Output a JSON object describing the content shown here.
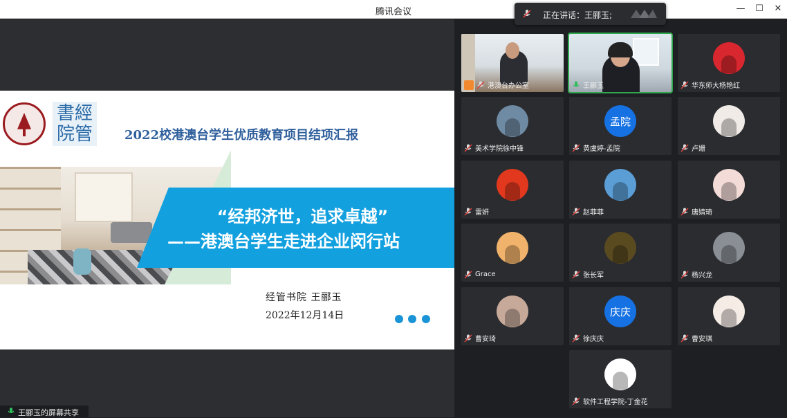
{
  "window": {
    "title": "腾讯会议",
    "minimize": "—",
    "maximize": "☐",
    "close": "✕"
  },
  "speaking": {
    "label": "正在讲话：王郦玉;"
  },
  "slide": {
    "title": "2022校港澳台学生优质教育项目结项汇报",
    "callig": "書經\n院管",
    "banner_line1": "“经邦济世，追求卓越”",
    "banner_line2": "——港澳台学生走进企业闵行站",
    "presenter": "经管书院 王郦玉",
    "date": "2022年12月14日"
  },
  "share_label": "王郦玉的屏幕共享",
  "participants": [
    {
      "name": "港澳台办公室",
      "type": "video"
    },
    {
      "name": "王郦玉",
      "type": "video",
      "active": true
    },
    {
      "name": "华东师大杨艳红",
      "type": "photo",
      "color": "#d8272f"
    },
    {
      "name": "美术学院徐中锋",
      "type": "photo",
      "color": "#6f8aa3"
    },
    {
      "name": "黄虞婷-孟院",
      "type": "text",
      "initials": "孟院"
    },
    {
      "name": "卢姗",
      "type": "photo",
      "color": "#f0ebe7"
    },
    {
      "name": "雷妍",
      "type": "photo",
      "color": "#e2381e"
    },
    {
      "name": "赵菲菲",
      "type": "photo",
      "color": "#5b9ed6"
    },
    {
      "name": "唐婧琦",
      "type": "photo",
      "color": "#f3dcd8"
    },
    {
      "name": "Grace",
      "type": "photo",
      "color": "#f1b36b"
    },
    {
      "name": "张长军",
      "type": "photo",
      "color": "#5a4a20"
    },
    {
      "name": "杨兴龙",
      "type": "photo",
      "color": "#8a8f95"
    },
    {
      "name": "曹安琦",
      "type": "photo",
      "color": "#c7a99a"
    },
    {
      "name": "徐庆庆",
      "type": "text",
      "initials": "庆庆"
    },
    {
      "name": "曹安琪",
      "type": "photo",
      "color": "#f5ece6"
    },
    {
      "name": "软件工程学院-丁金花",
      "type": "photo",
      "color": "#ffffff"
    }
  ]
}
